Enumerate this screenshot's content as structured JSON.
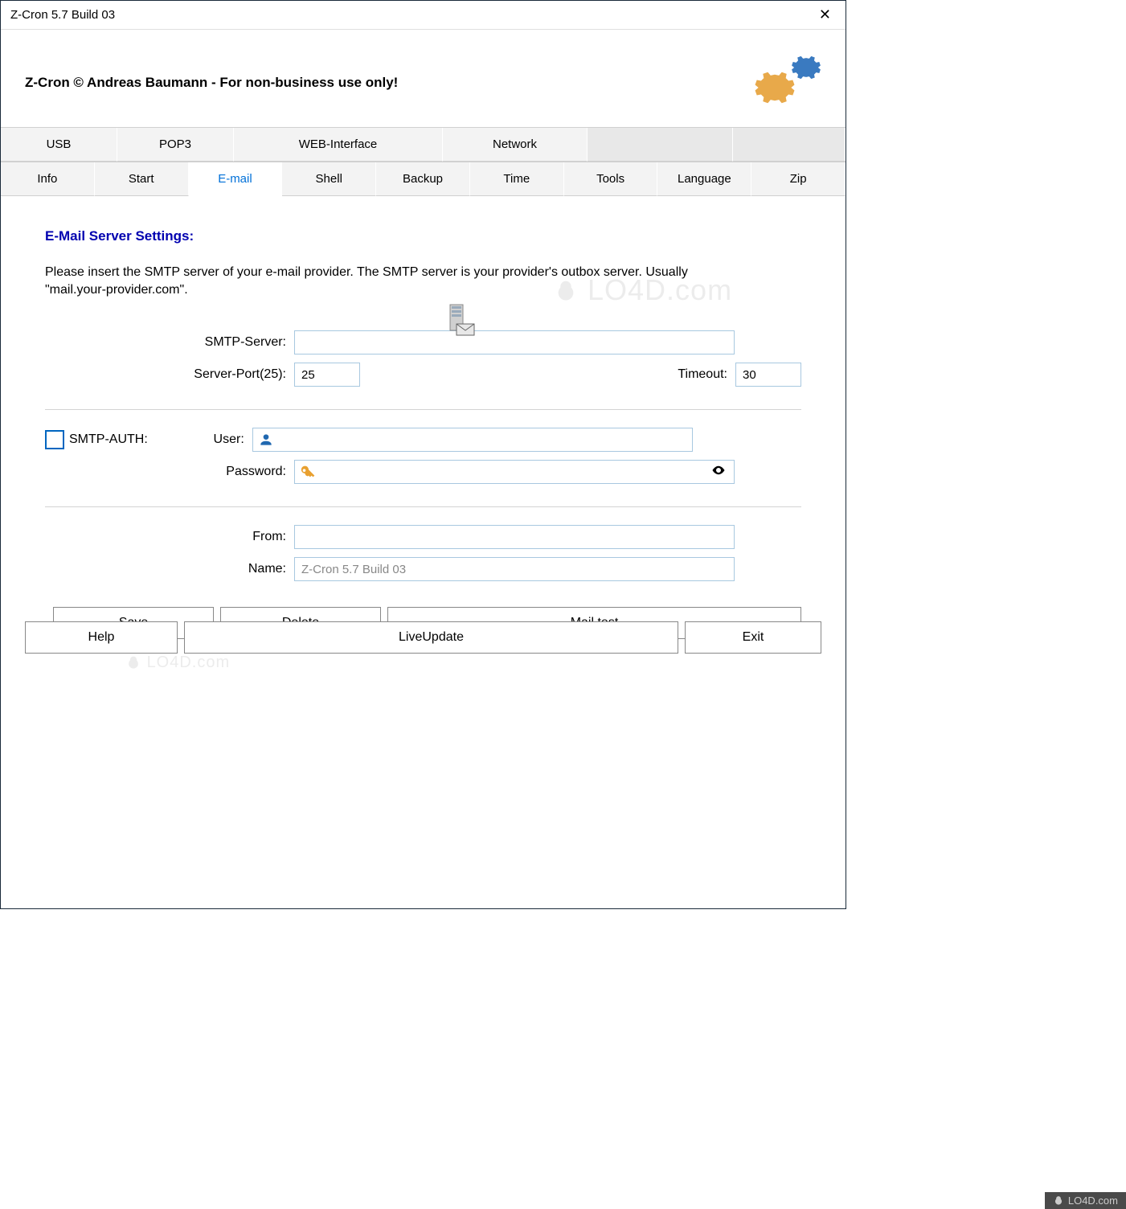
{
  "window": {
    "title": "Z-Cron 5.7 Build 03"
  },
  "header": {
    "text": "Z-Cron © Andreas Baumann - For non-business use only!"
  },
  "tabs_row1": [
    {
      "label": "USB"
    },
    {
      "label": "POP3"
    },
    {
      "label": "WEB-Interface"
    },
    {
      "label": "Network"
    },
    {
      "label": ""
    },
    {
      "label": ""
    }
  ],
  "tabs_row2": [
    {
      "label": "Info"
    },
    {
      "label": "Start"
    },
    {
      "label": "E-mail",
      "active": true
    },
    {
      "label": "Shell"
    },
    {
      "label": "Backup"
    },
    {
      "label": "Time"
    },
    {
      "label": "Tools"
    },
    {
      "label": "Language"
    },
    {
      "label": "Zip"
    }
  ],
  "panel": {
    "heading": "E-Mail Server Settings:",
    "description": "Please insert the SMTP server of your e-mail provider. The SMTP server is  your provider's outbox server. Usually \"mail.your-provider.com\".",
    "smtp_server_label": "SMTP-Server:",
    "smtp_server_value": "",
    "server_port_label": "Server-Port(25):",
    "server_port_value": "25",
    "timeout_label": "Timeout:",
    "timeout_value": "30",
    "smtp_auth_label": "SMTP-AUTH:",
    "user_label": "User:",
    "user_value": "",
    "password_label": "Password:",
    "password_value": "",
    "from_label": "From:",
    "from_value": "",
    "name_label": "Name:",
    "name_value": "Z-Cron 5.7 Build 03"
  },
  "buttons": {
    "save": "Save",
    "delete": "Delete",
    "mailtest": "Mail test",
    "help": "Help",
    "liveupdate": "LiveUpdate",
    "exit": "Exit"
  },
  "watermark": "LO4D.com",
  "footer": "LO4D.com"
}
